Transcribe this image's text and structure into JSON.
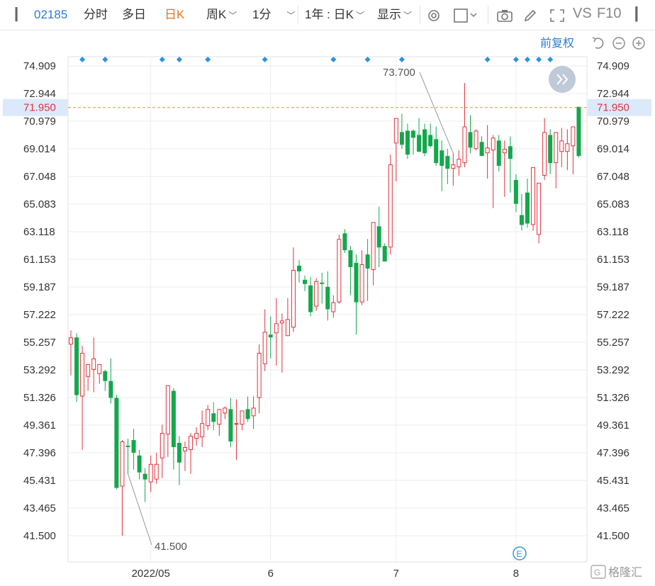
{
  "toolbar": {
    "code": "02185",
    "intraday": "分时",
    "multiday": "多日",
    "daily": "日K",
    "weekly": "周K",
    "minute": "1分",
    "range": "1年 : 日K",
    "display": "显示",
    "vs": "VS",
    "f10": "F10"
  },
  "controls": {
    "adjust_label": "前复权"
  },
  "watermark": "格隆汇",
  "colors": {
    "up": "#e0323c",
    "down": "#12a84b",
    "price_line": "#e5913f",
    "accent": "#2d7bd5"
  },
  "chart_data": {
    "type": "candlestick",
    "y_ticks": [
      "74.909",
      "72.944",
      "70.979",
      "69.014",
      "67.048",
      "65.083",
      "63.118",
      "61.153",
      "59.187",
      "57.222",
      "55.257",
      "53.292",
      "51.326",
      "49.361",
      "47.396",
      "45.431",
      "43.465",
      "41.500"
    ],
    "ylim": [
      41.5,
      74.909
    ],
    "x_ticks": [
      {
        "label": "2022/05",
        "index": 14
      },
      {
        "label": "6",
        "index": 35
      },
      {
        "label": "7",
        "index": 57
      },
      {
        "label": "8",
        "index": 78
      }
    ],
    "current_price": 71.95,
    "current_price_label": "71.950",
    "high_label": "73.700",
    "high_index": 67,
    "low_label": "41.500",
    "low_index": 10,
    "event_marker_indices": [
      2,
      6,
      16,
      19,
      24,
      34,
      46,
      52,
      58,
      73,
      78,
      80,
      82,
      84
    ],
    "candles": [
      [
        55.1,
        56.1,
        52.9,
        55.6
      ],
      [
        55.6,
        55.9,
        51.0,
        51.5
      ],
      [
        51.4,
        55.0,
        47.6,
        54.5
      ],
      [
        52.8,
        53.3,
        51.8,
        53.7
      ],
      [
        53.3,
        55.6,
        51.7,
        54.1
      ],
      [
        53.0,
        53.5,
        52.3,
        53.7
      ],
      [
        53.2,
        53.3,
        51.8,
        52.5
      ],
      [
        52.5,
        54.1,
        50.9,
        51.3
      ],
      [
        51.3,
        51.5,
        44.8,
        44.9
      ],
      [
        45.0,
        48.3,
        41.5,
        48.2
      ],
      [
        47.9,
        48.4,
        45.9,
        47.8
      ],
      [
        48.3,
        49.1,
        46.2,
        47.4
      ],
      [
        47.2,
        47.6,
        45.5,
        46.0
      ],
      [
        45.9,
        46.3,
        43.9,
        45.5
      ],
      [
        45.3,
        47.2,
        44.6,
        46.6
      ],
      [
        45.5,
        47.4,
        45.2,
        46.6
      ],
      [
        47.0,
        49.4,
        45.6,
        48.8
      ],
      [
        48.7,
        52.1,
        47.1,
        52.2
      ],
      [
        51.8,
        52.0,
        46.2,
        47.8
      ],
      [
        48.1,
        48.6,
        45.1,
        46.7
      ],
      [
        47.5,
        48.2,
        46.1,
        47.8
      ],
      [
        47.6,
        48.8,
        45.9,
        48.6
      ],
      [
        48.4,
        49.2,
        47.9,
        48.8
      ],
      [
        48.5,
        50.4,
        47.8,
        49.5
      ],
      [
        49.3,
        50.8,
        49.0,
        50.5
      ],
      [
        50.2,
        51.0,
        49.0,
        49.6
      ],
      [
        49.4,
        50.5,
        48.6,
        50.5
      ],
      [
        50.2,
        50.7,
        49.8,
        50.6
      ],
      [
        50.5,
        51.3,
        47.8,
        48.2
      ],
      [
        49.4,
        51.2,
        46.9,
        49.5
      ],
      [
        49.4,
        50.3,
        49.0,
        50.4
      ],
      [
        50.5,
        51.4,
        49.6,
        49.8
      ],
      [
        50.0,
        51.4,
        49.1,
        50.6
      ],
      [
        51.3,
        55.1,
        50.2,
        54.5
      ],
      [
        53.7,
        57.6,
        53.2,
        56.0
      ],
      [
        55.8,
        57.1,
        54.1,
        55.6
      ],
      [
        55.9,
        58.4,
        53.6,
        56.6
      ],
      [
        56.6,
        57.3,
        53.1,
        56.8
      ],
      [
        55.7,
        58.4,
        55.7,
        56.9
      ],
      [
        56.3,
        62.0,
        56.0,
        60.4
      ],
      [
        60.7,
        61.1,
        59.5,
        60.3
      ],
      [
        59.7,
        60.0,
        58.9,
        59.4
      ],
      [
        59.3,
        59.9,
        57.1,
        57.4
      ],
      [
        57.8,
        59.8,
        57.5,
        59.6
      ],
      [
        59.5,
        60.2,
        58.0,
        59.4
      ],
      [
        59.2,
        60.3,
        56.8,
        57.6
      ],
      [
        57.4,
        58.6,
        57.0,
        58.1
      ],
      [
        58.1,
        62.9,
        58.0,
        62.6
      ],
      [
        63.0,
        63.3,
        61.6,
        61.8
      ],
      [
        61.8,
        62.1,
        58.6,
        60.6
      ],
      [
        60.9,
        61.5,
        55.8,
        58.1
      ],
      [
        58.1,
        61.8,
        57.9,
        60.8
      ],
      [
        61.5,
        62.6,
        58.2,
        60.5
      ],
      [
        60.4,
        61.7,
        59.3,
        63.8
      ],
      [
        63.5,
        64.9,
        60.6,
        62.0
      ],
      [
        62.1,
        62.3,
        61.1,
        61.0
      ],
      [
        62.0,
        68.6,
        61.5,
        67.9
      ],
      [
        69.4,
        70.9,
        66.7,
        71.2
      ],
      [
        70.2,
        71.5,
        69.0,
        69.3
      ],
      [
        70.3,
        70.8,
        68.3,
        68.6
      ],
      [
        70.3,
        70.4,
        68.6,
        69.8
      ],
      [
        70.0,
        71.2,
        69.0,
        68.8
      ],
      [
        70.4,
        70.8,
        68.5,
        68.7
      ],
      [
        70.0,
        70.8,
        69.1,
        69.2
      ],
      [
        69.7,
        70.6,
        67.8,
        68.0
      ],
      [
        68.9,
        69.6,
        66.0,
        67.8
      ],
      [
        68.5,
        69.0,
        66.5,
        67.6
      ],
      [
        67.6,
        68.7,
        66.4,
        67.9
      ],
      [
        67.7,
        68.9,
        67.1,
        68.3
      ],
      [
        68.0,
        73.7,
        67.7,
        70.6
      ],
      [
        70.2,
        71.4,
        68.7,
        69.1
      ],
      [
        69.0,
        70.4,
        68.9,
        70.3
      ],
      [
        69.5,
        69.9,
        68.5,
        68.5
      ],
      [
        68.7,
        70.7,
        66.9,
        69.1
      ],
      [
        68.9,
        70.0,
        64.8,
        69.8
      ],
      [
        69.6,
        70.0,
        67.4,
        67.8
      ],
      [
        68.7,
        69.6,
        65.6,
        69.0
      ],
      [
        69.2,
        69.9,
        65.9,
        68.3
      ],
      [
        66.8,
        67.2,
        64.5,
        65.1
      ],
      [
        64.3,
        65.8,
        63.2,
        63.6
      ],
      [
        65.9,
        66.9,
        63.4,
        63.7
      ],
      [
        63.6,
        66.0,
        63.2,
        67.7
      ],
      [
        62.9,
        65.2,
        62.3,
        66.6
      ],
      [
        67.1,
        71.2,
        66.8,
        70.2
      ],
      [
        70.0,
        70.4,
        67.2,
        68.0
      ],
      [
        68.0,
        69.6,
        66.2,
        70.2
      ],
      [
        68.8,
        70.5,
        67.7,
        69.6
      ],
      [
        68.8,
        70.4,
        67.5,
        69.4
      ],
      [
        69.2,
        69.4,
        67.2,
        70.6
      ],
      [
        72.0,
        71.6,
        68.4,
        68.5
      ]
    ]
  }
}
